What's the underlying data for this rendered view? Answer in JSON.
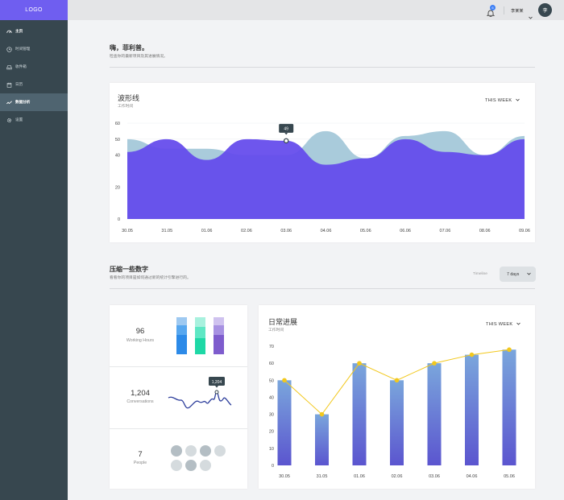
{
  "sidebar": {
    "logo": "LOGO",
    "items": [
      {
        "label": "主页",
        "icon": "dashboard-icon"
      },
      {
        "label": "时间管理",
        "icon": "clock-icon"
      },
      {
        "label": "收件箱",
        "icon": "inbox-icon"
      },
      {
        "label": "日历",
        "icon": "calendar-icon"
      },
      {
        "label": "数据分析",
        "icon": "analytics-icon"
      },
      {
        "label": "设置",
        "icon": "gear-icon"
      }
    ]
  },
  "topbar": {
    "notification_count": "6",
    "username": "李某某",
    "avatar_initial": "李"
  },
  "greeting": {
    "title": "嗨，菲利普。",
    "subtitle": "检查你的最新项目及其进展情况。"
  },
  "wave_card": {
    "title": "波形线",
    "subtitle": "工作时间",
    "period": "THIS WEEK"
  },
  "numbers_section": {
    "title": "压缩一些数字",
    "subtitle": "看看你的项目是如何通过新的统计引擎进行的。",
    "timeframe_label": "Timeline",
    "timeframe_value": "7 days"
  },
  "stats": {
    "working_hours": {
      "value": "96",
      "label": "Working Hours"
    },
    "conversations": {
      "value": "1,204",
      "label": "Conversations",
      "tooltip": "1,204"
    },
    "people": {
      "value": "7",
      "label": "People"
    }
  },
  "progress_card": {
    "title": "日常进展",
    "subtitle": "工作时间",
    "period": "THIS WEEK"
  },
  "colors": {
    "accent": "#6f5ef0",
    "sidebar": "#37474f",
    "wave_light": "#a9cbdb",
    "wave_dark": "#6349ec",
    "line_yellow": "#f2c81e"
  },
  "chart_data": [
    {
      "type": "area",
      "x": [
        "30.05",
        "31.05",
        "01.06",
        "02.06",
        "03.06",
        "04.06",
        "05.06",
        "06.06",
        "07.06",
        "08.06",
        "09.06"
      ],
      "ylim": [
        0,
        60
      ],
      "yticks": [
        0,
        20,
        40,
        50,
        60
      ],
      "tooltip": {
        "x_index": 4,
        "value": "49"
      },
      "series": [
        {
          "values": [
            50,
            44,
            44,
            40,
            40,
            55,
            38,
            52,
            55,
            40,
            52
          ]
        },
        {
          "values": [
            42,
            50,
            37,
            50,
            49,
            34,
            38,
            50,
            42,
            40,
            50
          ]
        }
      ]
    },
    {
      "type": "bar",
      "categories": [
        "30.05",
        "31.05",
        "01.06",
        "02.06",
        "03.06",
        "04.06",
        "05.06"
      ],
      "ylim": [
        0,
        70
      ],
      "yticks": [
        0,
        10,
        20,
        30,
        40,
        50,
        60,
        70
      ],
      "values": [
        50,
        30,
        60,
        50,
        60,
        65,
        68
      ],
      "line_values": [
        50,
        30,
        60,
        50,
        60,
        65,
        68
      ]
    }
  ]
}
